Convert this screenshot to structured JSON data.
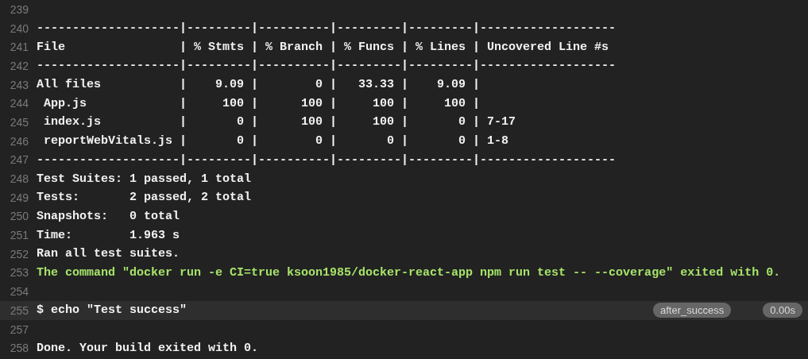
{
  "log_lines": [
    {
      "number": "239",
      "kind": "plain"
    },
    {
      "number": "240",
      "kind": "plain",
      "text": "--------------------|---------|----------|---------|---------|-------------------"
    },
    {
      "number": "241",
      "kind": "plain",
      "text": "File                | % Stmts | % Branch | % Funcs | % Lines | Uncovered Line #s"
    },
    {
      "number": "242",
      "kind": "plain",
      "text": "--------------------|---------|----------|---------|---------|-------------------"
    },
    {
      "number": "243",
      "kind": "plain",
      "text": "All files           |    9.09 |        0 |   33.33 |    9.09 |"
    },
    {
      "number": "244",
      "kind": "plain",
      "text": " App.js             |     100 |      100 |     100 |     100 |"
    },
    {
      "number": "245",
      "kind": "plain",
      "text": " index.js           |       0 |      100 |     100 |       0 | 7-17"
    },
    {
      "number": "246",
      "kind": "plain",
      "text": " reportWebVitals.js |       0 |        0 |       0 |       0 | 1-8"
    },
    {
      "number": "247",
      "kind": "plain",
      "text": "--------------------|---------|----------|---------|---------|-------------------"
    },
    {
      "number": "248",
      "kind": "plain",
      "text": "Test Suites: 1 passed, 1 total"
    },
    {
      "number": "249",
      "kind": "plain",
      "text": "Tests:       2 passed, 2 total"
    },
    {
      "number": "250",
      "kind": "plain",
      "text": "Snapshots:   0 total"
    },
    {
      "number": "251",
      "kind": "plain",
      "text": "Time:        1.963 s"
    },
    {
      "number": "252",
      "kind": "plain",
      "text": "Ran all test suites."
    },
    {
      "number": "253",
      "kind": "success",
      "text": "The command \"docker run -e CI=true ksoon1985/docker-react-app npm run test -- --coverage\" exited with 0."
    },
    {
      "number": "254",
      "kind": "plain"
    },
    {
      "number": "255",
      "kind": "fold",
      "text": "$ echo \"Test success\"",
      "tag": "after_success",
      "duration": "0.00s"
    },
    {
      "number": "257",
      "kind": "plain"
    },
    {
      "number": "258",
      "kind": "plain",
      "text": "Done. Your build exited with 0."
    }
  ]
}
